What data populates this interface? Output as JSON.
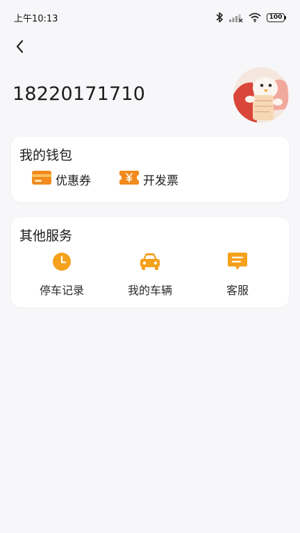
{
  "status_bar": {
    "time": "上午10:13",
    "battery": "100"
  },
  "profile": {
    "phone": "18220171710"
  },
  "wallet": {
    "title": "我的钱包",
    "items": [
      {
        "label": "优惠券",
        "icon": "coupon-card-icon"
      },
      {
        "label": "开发票",
        "icon": "invoice-ticket-icon"
      }
    ]
  },
  "services": {
    "title": "其他服务",
    "items": [
      {
        "label": "停车记录",
        "icon": "clock-icon"
      },
      {
        "label": "我的车辆",
        "icon": "car-icon"
      },
      {
        "label": "客服",
        "icon": "message-icon"
      }
    ]
  },
  "colors": {
    "accent": "#f5a11c",
    "accent_dark": "#ef7f1a",
    "background": "#f7f7f9",
    "card": "#ffffff"
  }
}
